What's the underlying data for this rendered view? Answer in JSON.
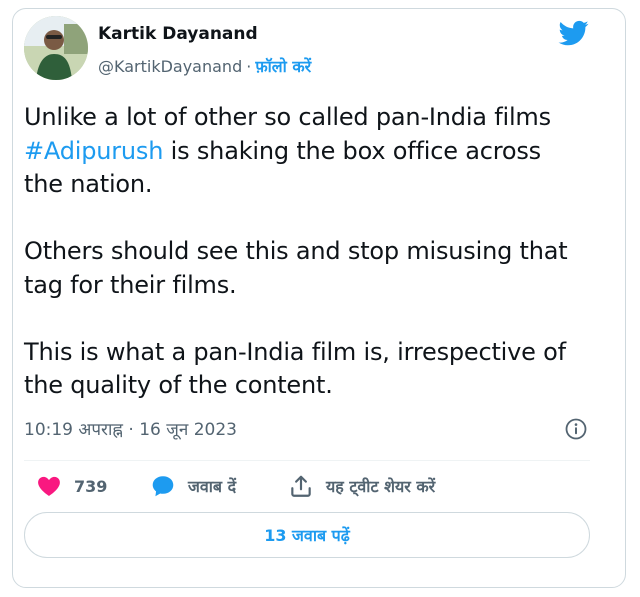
{
  "author": {
    "name": "Kartik Dayanand",
    "handle": "@KartikDayanand",
    "separator": "·",
    "follow_label": "फ़ॉलो करें"
  },
  "tweet": {
    "line1": "Unlike a lot of other so called pan-India films",
    "hashtag": "#Adipurush",
    "line2_rest": " is shaking the box office across",
    "line3": "the nation.",
    "paragraph2": "Others should see this and stop misusing that\ntag for their films.",
    "paragraph3": "This is what a pan-India film is, irrespective of\nthe quality of the content."
  },
  "meta": {
    "time": "10:19 अपराह्न",
    "separator": "·",
    "date": "16 जून 2023"
  },
  "actions": {
    "likes": "739",
    "reply_label": "जवाब दें",
    "share_label": "यह ट्वीट शेयर करें"
  },
  "replies_button": "13 जवाब पढ़ें",
  "colors": {
    "accent": "#1d9bf0",
    "like": "#f91880",
    "muted": "#536471",
    "border": "#cfd9de"
  },
  "icons": [
    "twitter-bird-icon",
    "info-icon",
    "heart-icon",
    "reply-bubble-icon",
    "share-icon"
  ]
}
